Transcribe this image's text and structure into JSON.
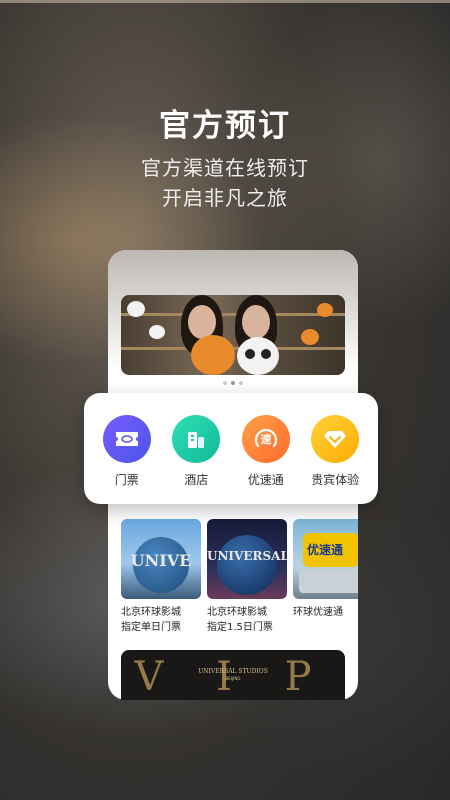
{
  "hero": {
    "title": "官方预订",
    "subtitle_line1": "官方渠道在线预订",
    "subtitle_line2": "开启非凡之旅"
  },
  "quick_actions": [
    {
      "label": "门票",
      "icon": "ticket-icon",
      "color": "#5b4ff0"
    },
    {
      "label": "酒店",
      "icon": "hotel-icon",
      "color": "#18c9a6"
    },
    {
      "label": "优速通",
      "icon": "express-icon",
      "color": "#ff7a2f"
    },
    {
      "label": "贵宾体验",
      "icon": "vip-diamond-icon",
      "color": "#ffb300"
    }
  ],
  "products": [
    {
      "name_line1": "北京环球影城",
      "name_line2": "指定单日门票",
      "image": "universal-globe"
    },
    {
      "name_line1": "北京环球影城",
      "name_line2": "指定1.5日门票",
      "image": "universal-globe-night"
    },
    {
      "name_line1": "环球优速通",
      "name_line2": "",
      "image": "express-pass"
    }
  ],
  "banner": {
    "image": "girls-with-tiger-panda-plush"
  },
  "carousel": {
    "count": 3,
    "active": 1
  },
  "vip_banner": {
    "text": "UNIVERSAL STUDIOS",
    "sub": "BEIJING",
    "letters": "V I P"
  }
}
